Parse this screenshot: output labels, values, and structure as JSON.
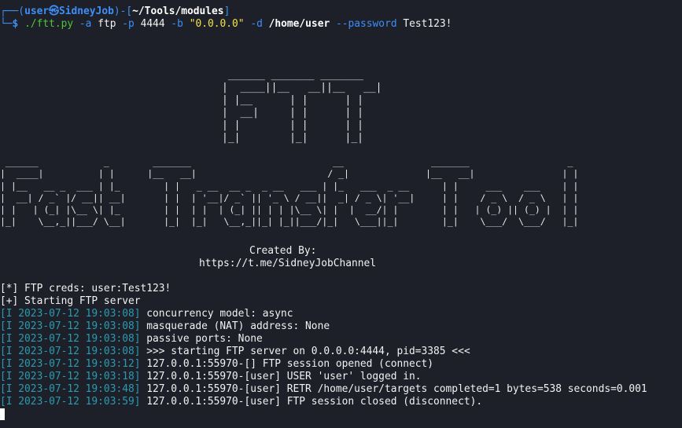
{
  "prompt": {
    "corner_top": "┌──",
    "corner_bottom": "└─",
    "open_paren": "(",
    "user": "user",
    "at_symbol": "㉿",
    "host": "SidneyJob",
    "close_paren": ")",
    "dash": "-",
    "open_bracket": "[",
    "cwd": "~/Tools/modules",
    "close_bracket": "]",
    "dollar": "$"
  },
  "command": {
    "executable": "./ftt.py",
    "flag_a": "-a",
    "value_a": "ftp",
    "flag_p": "-p",
    "value_p": "4444",
    "flag_b": "-b",
    "value_b": "\"0.0.0.0\"",
    "flag_d": "-d",
    "value_d": "/home/user",
    "flag_password": "--password",
    "value_password": "Test123!"
  },
  "banner": {
    "ftt_ascii": " ______ _______ _______\n|  ____||__   __||__   __|\n| |__      | |      | |\n|  __|     | |      | |\n| |        | |      | |\n|_|        |_|      |_|",
    "big_ascii": " ______            _        _______                          __                _______                  _ \n|  ____|          | |      |__   __|                        / _|              |__   __|                | |\n| |__   __ _  ___ | |_        | |   _ __  __ _  _ __   ___ | |_   ___  _ __      | |     ___    ___    | |\n|  __| / _` |/ __|| __|       | |  | '__|/ _` || '_ \\ / __||  _| / _ \\| '__|     | |    / _ \\  / _ \\   | |\n| |   | (_| |\\__ \\| |_        | |  | |  | (_| || | | |\\__ \\| |  |  __/| |        | |   | (_) || (_) |  | |\n|_|    \\__,_||___/ \\__|       |_|  |_|   \\__,_||_| |_||___/|_|   \\___||_|        |_|    \\___/  \\___/   |_|",
    "created_by": "Created By:",
    "channel_url": "https://t.me/SidneyJobChannel"
  },
  "output": {
    "creds_line": "[*] FTP creds: user:Test123!",
    "starting_line": "[+] Starting FTP server",
    "logs": [
      {
        "prefix": "[I 2023-07-12 19:03:08]",
        "message": "concurrency model: async"
      },
      {
        "prefix": "[I 2023-07-12 19:03:08]",
        "message": "masquerade (NAT) address: None"
      },
      {
        "prefix": "[I 2023-07-12 19:03:08]",
        "message": "passive ports: None"
      },
      {
        "prefix": "[I 2023-07-12 19:03:08]",
        "message": ">>> starting FTP server on 0.0.0.0:4444, pid=3385 <<<"
      },
      {
        "prefix": "[I 2023-07-12 19:03:12]",
        "message": "127.0.0.1:55970-[] FTP session opened (connect)"
      },
      {
        "prefix": "[I 2023-07-12 19:03:18]",
        "message": "127.0.0.1:55970-[user] USER 'user' logged in."
      },
      {
        "prefix": "[I 2023-07-12 19:03:48]",
        "message": "127.0.0.1:55970-[user] RETR /home/user/targets completed=1 bytes=538 seconds=0.001"
      },
      {
        "prefix": "[I 2023-07-12 19:03:59]",
        "message": "127.0.0.1:55970-[user] FTP session closed (disconnect)."
      }
    ]
  },
  "colors": {
    "background": "#1e2029",
    "prompt_blue": "#3d8ff6",
    "command_green": "#4ec33a",
    "string_yellow": "#f0e14a",
    "log_prefix_cyan": "#2a9bb0"
  }
}
